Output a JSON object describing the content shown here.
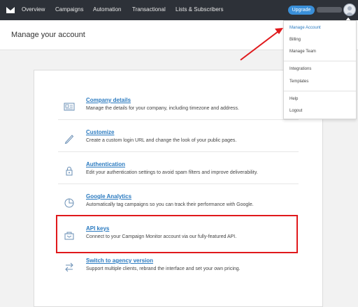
{
  "nav": {
    "items": [
      "Overview",
      "Campaigns",
      "Automation",
      "Transactional",
      "Lists & Subscribers"
    ],
    "upgrade_label": "Upgrade"
  },
  "header": {
    "title": "Manage your account"
  },
  "settings": [
    {
      "title": "Company details",
      "desc": "Manage the details for your company, including timezone and address.",
      "icon": "id-card-icon"
    },
    {
      "title": "Customize",
      "desc": "Create a custom login URL and change the look of your public pages.",
      "icon": "pen-icon"
    },
    {
      "title": "Authentication",
      "desc": "Edit your authentication settings to avoid spam filters and improve deliverability.",
      "icon": "lock-icon"
    },
    {
      "title": "Google Analytics",
      "desc": "Automatically tag campaigns so you can track their performance with Google.",
      "icon": "pie-chart-icon"
    },
    {
      "title": "API keys",
      "desc": "Connect to your Campaign Monitor account via our fully-featured API.",
      "icon": "briefcase-icon"
    },
    {
      "title": "Switch to agency version",
      "desc": "Support multiple clients, rebrand the interface and set your own pricing.",
      "icon": "swap-arrows-icon"
    }
  ],
  "dropdown": {
    "items": [
      "Manage Account",
      "Billing",
      "Manage Team",
      "Integrations",
      "Templates",
      "Help",
      "Logout"
    ],
    "active_color": "#2a7ac0"
  },
  "colors": {
    "nav_bg": "#2d3138",
    "link": "#2a7ac0",
    "upgrade": "#3a8fd8",
    "annotation": "#e0191c"
  }
}
